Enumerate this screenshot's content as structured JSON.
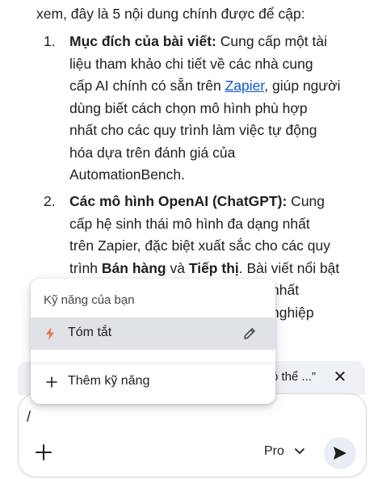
{
  "article": {
    "intro": "xem, đây là 5 nội dung chính được để cập:",
    "items": [
      {
        "num": "1.",
        "lines": [
          {
            "bold": "Mục đích của bài viết:",
            "text": " Cung cấp một tài"
          },
          {
            "text": "liệu tham khảo chi tiết về các nhà cung"
          },
          {
            "pre": "cấp AI chính có sẵn trên ",
            "link": "Zapier",
            "post": ", giúp người"
          },
          {
            "text": "dùng biết cách chọn mô hình phù hợp"
          },
          {
            "text": "nhất cho các quy trình làm việc tự động"
          },
          {
            "text": "hóa dựa trên đánh giá của"
          },
          {
            "text": "AutomationBench."
          }
        ]
      },
      {
        "num": "2.",
        "lines": [
          {
            "bold": "Các mô hình OpenAI (ChatGPT):",
            "text": " Cung"
          },
          {
            "text": "cấp hệ sinh thái mô hình đa dạng nhất"
          },
          {
            "text": "trên Zapier, đặc biệt xuất sắc cho các quy"
          },
          {
            "pre": "trình ",
            "bold1": "Bán hàng",
            "mid": " và ",
            "bold2": "Tiếp thị",
            "post": ". Bài viết nổi bật"
          },
          {
            "text": "nhất"
          },
          {
            "text": "nghiệp"
          }
        ]
      }
    ]
  },
  "banner": {
    "text": "ó thể ...”",
    "close_icon": "close-icon"
  },
  "popup": {
    "title": "Kỹ năng của bạn",
    "items": [
      {
        "label": "Tóm tắt",
        "icon": "bolt-icon",
        "action_icon": "pencil-icon"
      }
    ],
    "add_label": "Thêm kỹ năng",
    "add_icon": "plus-icon"
  },
  "composer": {
    "value": "/",
    "add_icon": "plus-icon",
    "model_label": "Pro",
    "model_icon": "chevron-down-icon",
    "send_icon": "send-icon"
  },
  "colors": {
    "link": "#0b57d0",
    "bolt": "#f2734b",
    "selected_bg": "#dfe3e8",
    "send_bg": "#e9eef6"
  }
}
